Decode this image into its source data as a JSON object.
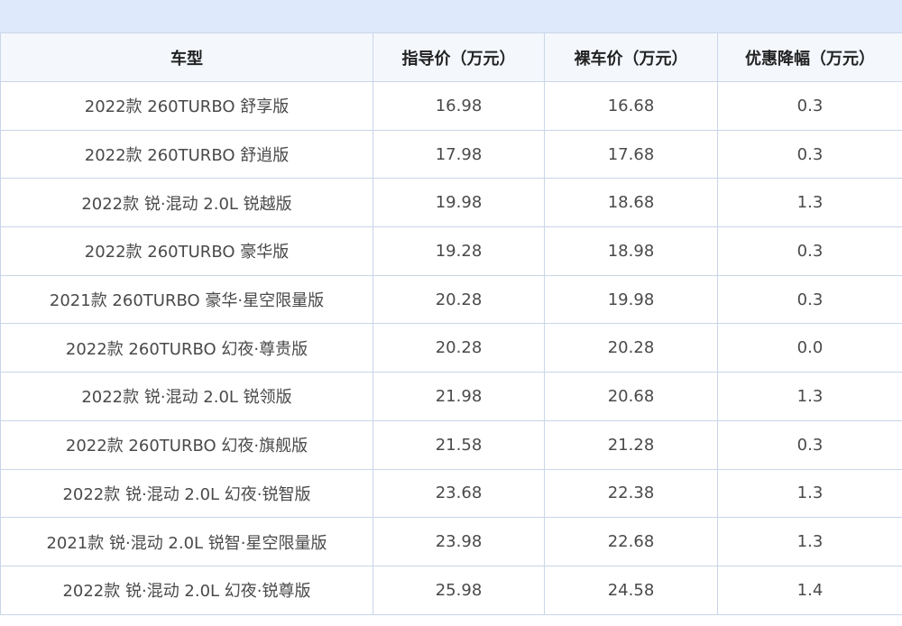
{
  "table": {
    "headers": [
      "车型",
      "指导价（万元）",
      "裸车价（万元）",
      "优惠降幅（万元）"
    ],
    "rows": [
      [
        "2022款 260TURBO 舒享版",
        "16.98",
        "16.68",
        "0.3"
      ],
      [
        "2022款 260TURBO 舒逍版",
        "17.98",
        "17.68",
        "0.3"
      ],
      [
        "2022款 锐·混动 2.0L 锐越版",
        "19.98",
        "18.68",
        "1.3"
      ],
      [
        "2022款 260TURBO 豪华版",
        "19.28",
        "18.98",
        "0.3"
      ],
      [
        "2021款 260TURBO 豪华·星空限量版",
        "20.28",
        "19.98",
        "0.3"
      ],
      [
        "2022款 260TURBO 幻夜·尊贵版",
        "20.28",
        "20.28",
        "0.0"
      ],
      [
        "2022款 锐·混动 2.0L 锐领版",
        "21.98",
        "20.68",
        "1.3"
      ],
      [
        "2022款 260TURBO 幻夜·旗舰版",
        "21.58",
        "21.28",
        "0.3"
      ],
      [
        "2022款 锐·混动 2.0L 幻夜·锐智版",
        "23.68",
        "22.38",
        "1.3"
      ],
      [
        "2021款 锐·混动 2.0L 锐智·星空限量版",
        "23.98",
        "22.68",
        "1.3"
      ],
      [
        "2022款 锐·混动 2.0L 幻夜·锐尊版",
        "25.98",
        "24.58",
        "1.4"
      ]
    ]
  },
  "colors": {
    "header_band": "#deeafc",
    "border": "#c9d6e8",
    "header_bg": "#f4f8fd"
  }
}
